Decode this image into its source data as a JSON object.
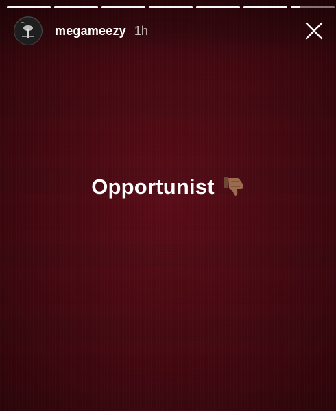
{
  "story": {
    "background_color": "#4a0a13",
    "progress": {
      "segments": [
        1,
        1,
        1,
        1,
        1,
        1,
        0.2
      ]
    },
    "header": {
      "username": "megameezy",
      "timestamp": "1h",
      "avatar_icon": "avatar-icon",
      "close_icon": "close-icon"
    },
    "caption": {
      "text": "Opportunist",
      "emoji_icon": "thumbs-down-icon"
    }
  }
}
